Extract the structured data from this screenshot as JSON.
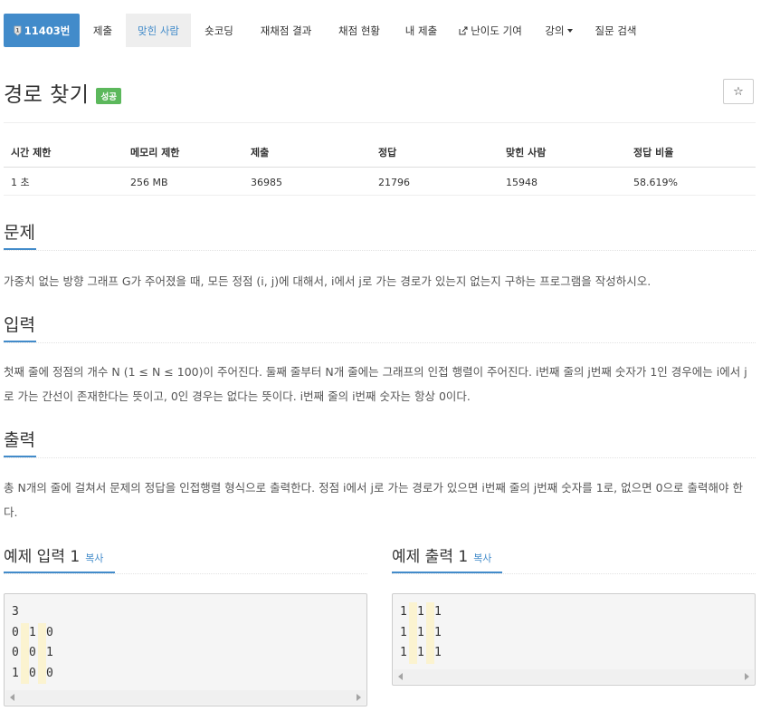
{
  "nav": {
    "problem_number": "11403번",
    "items": [
      {
        "label": "제출"
      },
      {
        "label": "맞힌 사람"
      },
      {
        "label": "숏코딩"
      },
      {
        "label": "재채점 결과"
      },
      {
        "label": "채점 현황"
      },
      {
        "label": "내 제출"
      },
      {
        "label": "난이도 기여"
      },
      {
        "label": "강의"
      },
      {
        "label": "질문 검색"
      }
    ],
    "active_item": "맞힌 사람"
  },
  "problem": {
    "title": "경로 찾기",
    "status_badge": "성공",
    "star_label": "☆"
  },
  "info_table": {
    "headers": [
      "시간 제한",
      "메모리 제한",
      "제출",
      "정답",
      "맞힌 사람",
      "정답 비율"
    ],
    "values": [
      "1 초",
      "256 MB",
      "36985",
      "21796",
      "15948",
      "58.619%"
    ]
  },
  "sections": {
    "description": {
      "title": "문제",
      "text": "가중치 없는 방향 그래프 G가 주어졌을 때, 모든 정점 (i, j)에 대해서, i에서 j로 가는 경로가 있는지 없는지 구하는 프로그램을 작성하시오."
    },
    "input": {
      "title": "입력",
      "text": "첫째 줄에 정점의 개수 N (1 ≤ N ≤ 100)이 주어진다. 둘째 줄부터 N개 줄에는 그래프의 인접 행렬이 주어진다. i번째 줄의 j번째 숫자가 1인 경우에는 i에서 j로 가는 간선이 존재한다는 뜻이고, 0인 경우는 없다는 뜻이다. i번째 줄의 i번째 숫자는 항상 0이다."
    },
    "output": {
      "title": "출력",
      "text": "총 N개의 줄에 걸쳐서 문제의 정답을 인접행렬 형식으로 출력한다. 정점 i에서 j로 가는 경로가 있으면 i번째 줄의 j번째 숫자를 1로, 없으면 0으로 출력해야 한다."
    }
  },
  "examples": {
    "input": {
      "title": "예제 입력 1",
      "copy_label": "복사",
      "lines": [
        "3",
        "0 1 0",
        "0 0 1",
        "1 0 0"
      ]
    },
    "output": {
      "title": "예제 출력 1",
      "copy_label": "복사",
      "lines": [
        "1 1 1",
        "1 1 1",
        "1 1 1"
      ]
    }
  },
  "colors": {
    "primary": "#428bca",
    "success": "#5cb85c",
    "whitespace_highlight": "#fbf3d0"
  }
}
